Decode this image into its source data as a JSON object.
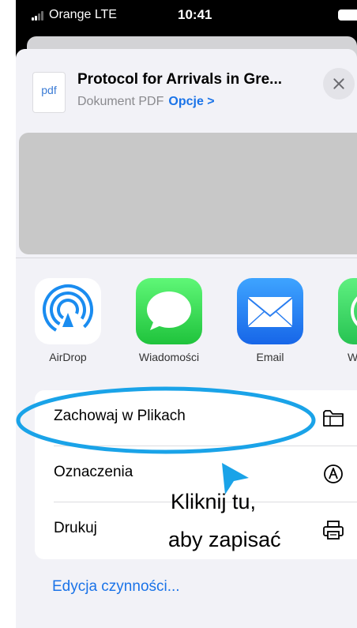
{
  "status_bar": {
    "carrier": "Orange  LTE",
    "time": "10:41"
  },
  "share_sheet": {
    "file": {
      "icon_text": "pdf",
      "title": "Protocol for Arrivals in Gre...",
      "subtitle": "Dokument PDF",
      "options_link": "Opcje >"
    },
    "apps": [
      {
        "label": "AirDrop",
        "icon": "airdrop-icon"
      },
      {
        "label": "Wiadomości",
        "icon": "messages-icon"
      },
      {
        "label": "Email",
        "icon": "mail-icon"
      },
      {
        "label": "Wh",
        "icon": "whatsapp-icon"
      }
    ],
    "actions": [
      {
        "label": "Zachowaj w Plikach",
        "icon": "folder-icon"
      },
      {
        "label": "Oznaczenia",
        "icon": "markup-icon"
      },
      {
        "label": "Drukuj",
        "icon": "printer-icon"
      }
    ],
    "edit_actions": "Edycja czynności..."
  },
  "annotation": {
    "line1": "Kliknij tu,",
    "line2": "aby zapisać",
    "color": "#1aa3e8"
  }
}
